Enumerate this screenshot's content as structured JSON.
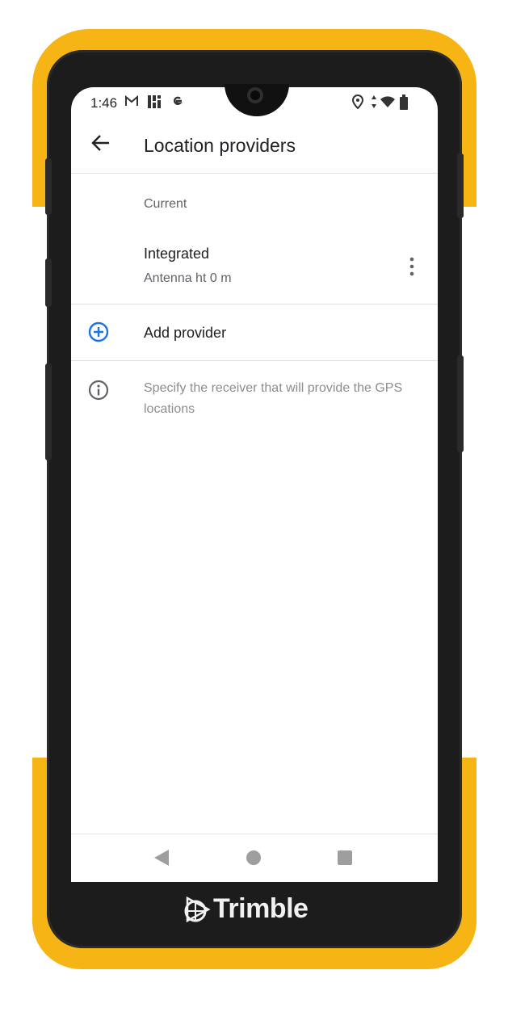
{
  "status_bar": {
    "time": "1:46",
    "left_icons": [
      "gmail-icon",
      "app-grid-icon",
      "google-icon"
    ],
    "right_icons": [
      "location-pin-icon",
      "data-arrows-icon",
      "wifi-icon",
      "battery-icon"
    ]
  },
  "app_bar": {
    "title": "Location providers"
  },
  "current_section": {
    "label": "Current",
    "provider_name": "Integrated",
    "provider_detail": "Antenna ht 0 m"
  },
  "add_provider": {
    "label": "Add provider"
  },
  "info": {
    "text": "Specify the receiver that will provide the GPS locations"
  },
  "brand": {
    "name": "Trimble"
  },
  "colors": {
    "accent": "#1a73e8",
    "bumper": "#f7b515"
  }
}
